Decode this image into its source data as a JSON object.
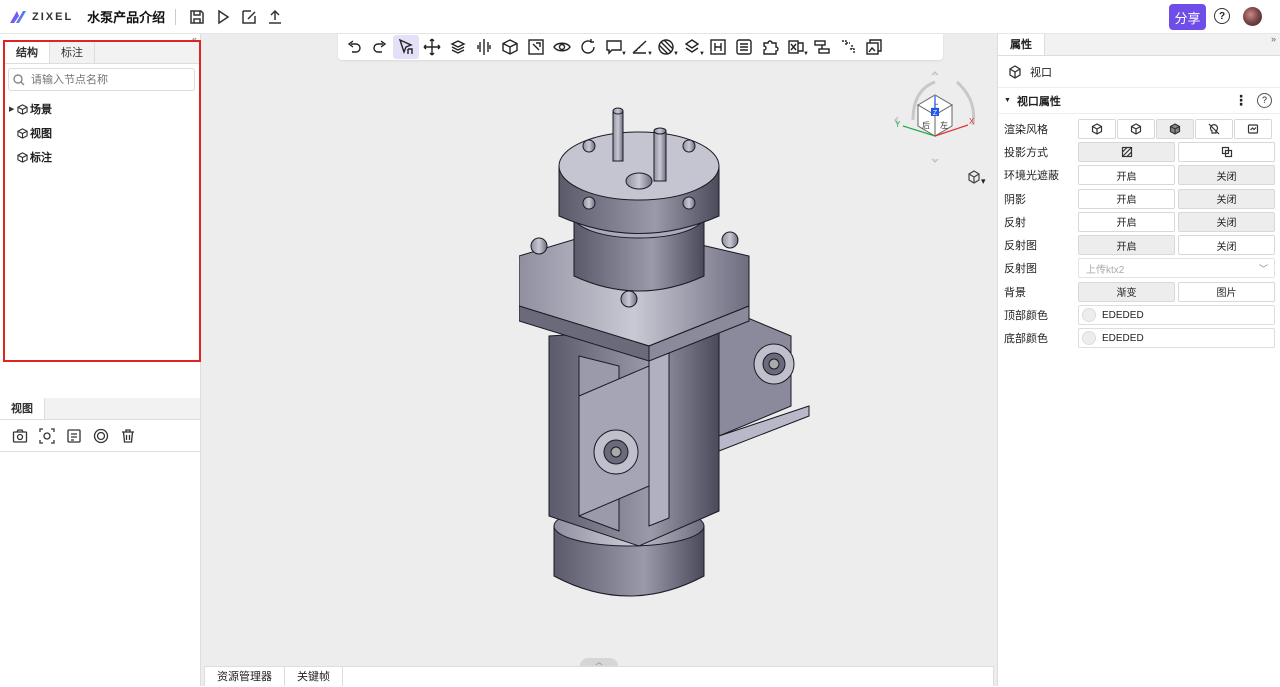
{
  "app": {
    "logo_text": "ZIXEL",
    "project_title": "水泵产品介绍",
    "share_label": "分享",
    "help_label": "?"
  },
  "left": {
    "tabs": [
      {
        "label": "结构"
      },
      {
        "label": "标注"
      }
    ],
    "search_placeholder": "请输入节点名称",
    "tree": [
      {
        "label": "场景"
      },
      {
        "label": "视图"
      },
      {
        "label": "标注"
      }
    ],
    "view_tab": "视图"
  },
  "bottom_tabs": [
    {
      "label": "资源管理器"
    },
    {
      "label": "关键帧"
    }
  ],
  "viewcube": {
    "top": "上",
    "front": "后",
    "right": "左",
    "axis_z": "Z",
    "axis_x": "X",
    "axis_y": "Y"
  },
  "right": {
    "tab": "属性",
    "viewport_label": "视口",
    "section_title": "视口属性",
    "rows": {
      "render_style": "渲染风格",
      "projection": "投影方式",
      "ao": "环境光遮蔽",
      "shadow": "阴影",
      "reflection": "反射",
      "reflection_map": "反射图",
      "reflection_map2": "反射图",
      "background": "背景",
      "top_color": "顶部颜色",
      "bottom_color": "底部颜色"
    },
    "on": "开启",
    "off": "关闭",
    "upload_placeholder": "上传ktx2",
    "bg_gradient": "渐变",
    "bg_image": "图片",
    "top_color_value": "EDEDED",
    "bottom_color_value": "EDEDED"
  },
  "colors": {
    "accent": "#6e4de8",
    "highlight": "#e02424",
    "canvas": "#ededed"
  }
}
